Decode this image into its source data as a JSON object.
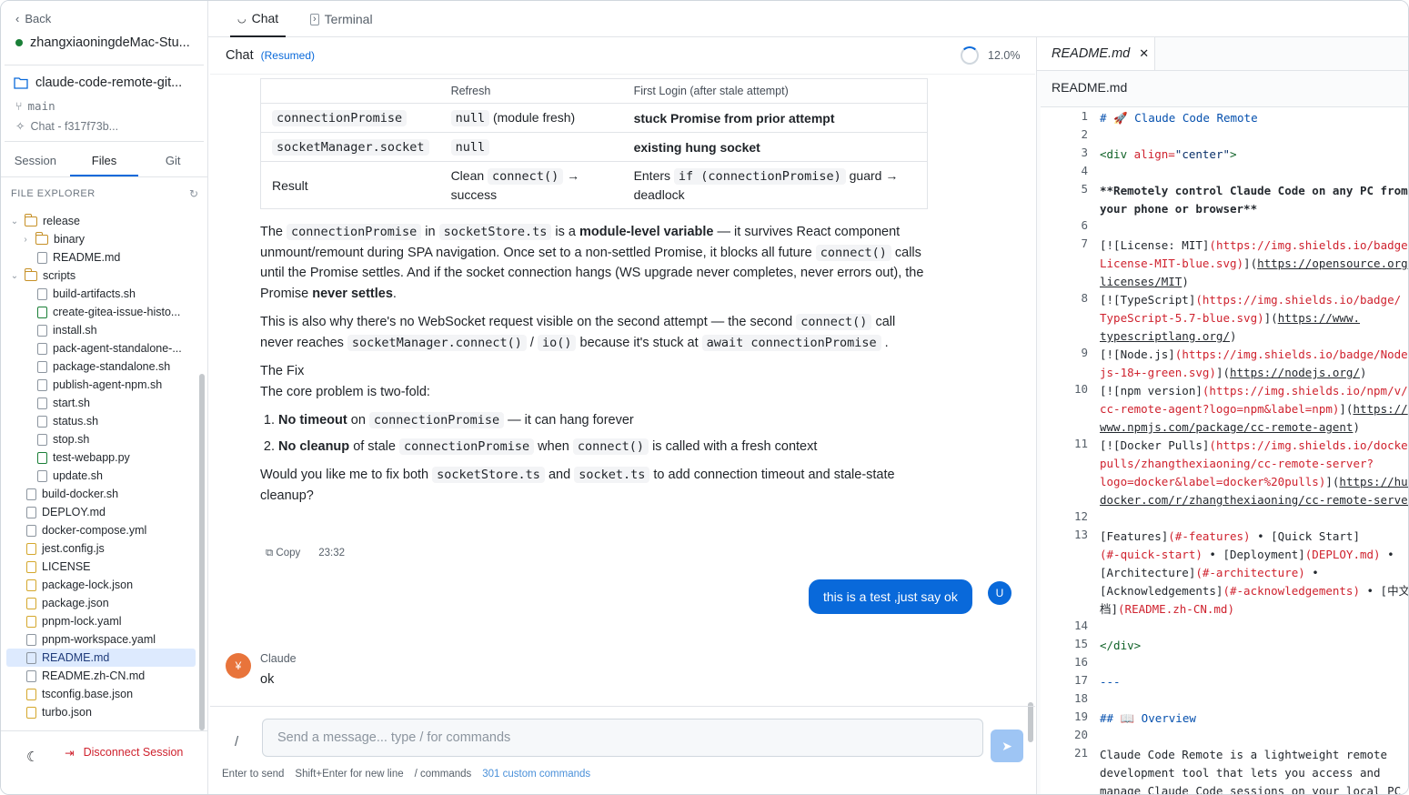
{
  "sidebar": {
    "back_label": "Back",
    "host": "zhangxiaoningdeMac-Stu...",
    "repo": "claude-code-remote-git...",
    "branch": "main",
    "chat_id": "Chat - f317f73b...",
    "tabs": [
      "Session",
      "Files",
      "Git"
    ],
    "active_tab": "Files",
    "explorer_title": "FILE EXPLORER",
    "tree": [
      {
        "name": "release",
        "type": "folder",
        "depth": 0,
        "open": true
      },
      {
        "name": "binary",
        "type": "folder",
        "depth": 1,
        "open": false
      },
      {
        "name": "README.md",
        "type": "file",
        "depth": 1,
        "color": "gray"
      },
      {
        "name": "scripts",
        "type": "folder",
        "depth": 0,
        "open": true
      },
      {
        "name": "build-artifacts.sh",
        "type": "file",
        "depth": 1,
        "color": "gray"
      },
      {
        "name": "create-gitea-issue-histo...",
        "type": "file",
        "depth": 1,
        "color": "green"
      },
      {
        "name": "install.sh",
        "type": "file",
        "depth": 1,
        "color": "gray"
      },
      {
        "name": "pack-agent-standalone-...",
        "type": "file",
        "depth": 1,
        "color": "gray"
      },
      {
        "name": "package-standalone.sh",
        "type": "file",
        "depth": 1,
        "color": "gray"
      },
      {
        "name": "publish-agent-npm.sh",
        "type": "file",
        "depth": 1,
        "color": "gray"
      },
      {
        "name": "start.sh",
        "type": "file",
        "depth": 1,
        "color": "gray"
      },
      {
        "name": "status.sh",
        "type": "file",
        "depth": 1,
        "color": "gray"
      },
      {
        "name": "stop.sh",
        "type": "file",
        "depth": 1,
        "color": "gray"
      },
      {
        "name": "test-webapp.py",
        "type": "file",
        "depth": 1,
        "color": "green"
      },
      {
        "name": "update.sh",
        "type": "file",
        "depth": 1,
        "color": "gray"
      },
      {
        "name": "build-docker.sh",
        "type": "file",
        "depth": 0,
        "color": "gray"
      },
      {
        "name": "DEPLOY.md",
        "type": "file",
        "depth": 0,
        "color": "gray"
      },
      {
        "name": "docker-compose.yml",
        "type": "file",
        "depth": 0,
        "color": "gray"
      },
      {
        "name": "jest.config.js",
        "type": "file",
        "depth": 0,
        "color": "yellow"
      },
      {
        "name": "LICENSE",
        "type": "file",
        "depth": 0,
        "color": "yellow"
      },
      {
        "name": "package-lock.json",
        "type": "file",
        "depth": 0,
        "color": "yellow"
      },
      {
        "name": "package.json",
        "type": "file",
        "depth": 0,
        "color": "yellow"
      },
      {
        "name": "pnpm-lock.yaml",
        "type": "file",
        "depth": 0,
        "color": "yellow"
      },
      {
        "name": "pnpm-workspace.yaml",
        "type": "file",
        "depth": 0,
        "color": "gray"
      },
      {
        "name": "README.md",
        "type": "file",
        "depth": 0,
        "color": "gray",
        "selected": true
      },
      {
        "name": "README.zh-CN.md",
        "type": "file",
        "depth": 0,
        "color": "gray"
      },
      {
        "name": "tsconfig.base.json",
        "type": "file",
        "depth": 0,
        "color": "yellow"
      },
      {
        "name": "turbo.json",
        "type": "file",
        "depth": 0,
        "color": "yellow"
      }
    ],
    "disconnect_label": "Disconnect Session"
  },
  "topbar": {
    "tabs": [
      "Chat",
      "Terminal"
    ],
    "active": "Chat"
  },
  "chat": {
    "title": "Chat",
    "status": "(Resumed)",
    "context_pct": "12.0%",
    "table": {
      "headers": [
        "",
        "Refresh",
        "First Login (after stale attempt)"
      ],
      "r1": {
        "c1": "connectionPromise",
        "c2_code": "null",
        "c2_text": "(module fresh)",
        "c3": "stuck Promise from prior attempt"
      },
      "r2": {
        "c1": "socketManager.socket",
        "c2_code": "null",
        "c3": "existing hung socket"
      },
      "r3": {
        "c1": "Result",
        "c2_a": "Clean",
        "c2_code": "connect()",
        "c2_b": "→ success",
        "c3_a": "Enters",
        "c3_code": "if (connectionPromise)",
        "c3_b": "guard → deadlock"
      }
    },
    "p1": {
      "a": "The",
      "code1": "connectionPromise",
      "b": "in",
      "code2": "socketStore.ts",
      "c": "is a",
      "bold1": "module-level variable",
      "d": "— it survives React component unmount/remount during SPA navigation. Once set to a non-settled Promise, it blocks all future",
      "code3": "connect()",
      "e": "calls until the Promise settles. And if the socket connection hangs (WS upgrade never completes, never errors out), the Promise",
      "bold2": "never settles",
      "f": "."
    },
    "p2": {
      "a": "This is also why there's no WebSocket request visible on the second attempt — the second",
      "code1": "connect()",
      "b": "call never reaches",
      "code2": "socketManager.connect()",
      "c": "/",
      "code3": "io()",
      "d": "because it's stuck at",
      "code4": "await connectionPromise",
      "e": "."
    },
    "fix_title": "The Fix",
    "fix_intro": "The core problem is two-fold:",
    "fix1": {
      "bold": "No timeout",
      "a": "on",
      "code": "connectionPromise",
      "b": "— it can hang forever"
    },
    "fix2": {
      "bold": "No cleanup",
      "a": "of stale",
      "code1": "connectionPromise",
      "b": "when",
      "code2": "connect()",
      "c": "is called with a fresh context"
    },
    "p3": {
      "a": "Would you like me to fix both",
      "code1": "socketStore.ts",
      "b": "and",
      "code2": "socket.ts",
      "c": "to add connection timeout and stale-state cleanup?"
    },
    "copy_label": "Copy",
    "copy_time": "23:32",
    "user_message": "this is a test ,just say ok",
    "user_avatar": "U",
    "assistant_name": "Claude",
    "assistant_reply": "ok",
    "composer_placeholder": "Send a message... type / for commands",
    "slash": "/",
    "hints": [
      "Enter to send",
      "Shift+Enter for new line",
      "/ commands"
    ],
    "custom_commands": "301 custom commands"
  },
  "editor": {
    "tab": "README.md",
    "path": "README.md",
    "line_numbers": [
      "1",
      "2",
      "3",
      "4",
      "5",
      "6",
      "7",
      "8",
      "9",
      "10",
      "11",
      "12",
      "13",
      "14",
      "15",
      "16",
      "17",
      "18",
      "19",
      "20",
      "21"
    ]
  }
}
